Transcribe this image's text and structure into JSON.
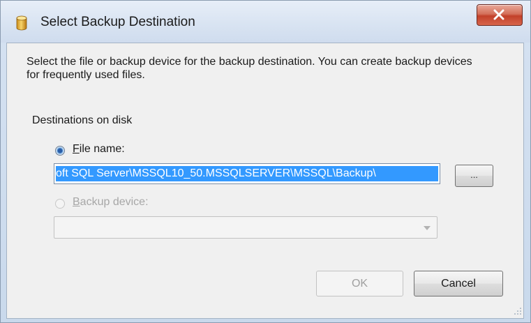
{
  "window": {
    "title": "Select Backup Destination",
    "icon": "database-cylinder-icon",
    "close_icon": "close-x-icon",
    "close_color": "#c7432b"
  },
  "instructions": "Select the file or backup device for the backup destination. You can create backup devices for frequently used files.",
  "destinations": {
    "label": "Destinations on disk",
    "file_option": {
      "label": "File name:",
      "selected": true,
      "value": "oft SQL Server\\MSSQL10_50.MSSQLSERVER\\MSSQL\\Backup\\"
    },
    "browse_label": "...",
    "device_option": {
      "label": "Backup device:",
      "selected": false,
      "enabled": false,
      "value": ""
    }
  },
  "buttons": {
    "ok_label": "OK",
    "ok_enabled": false,
    "cancel_label": "Cancel"
  },
  "colors": {
    "selection": "#3399ff",
    "disabled_text": "#a7a7a7"
  }
}
